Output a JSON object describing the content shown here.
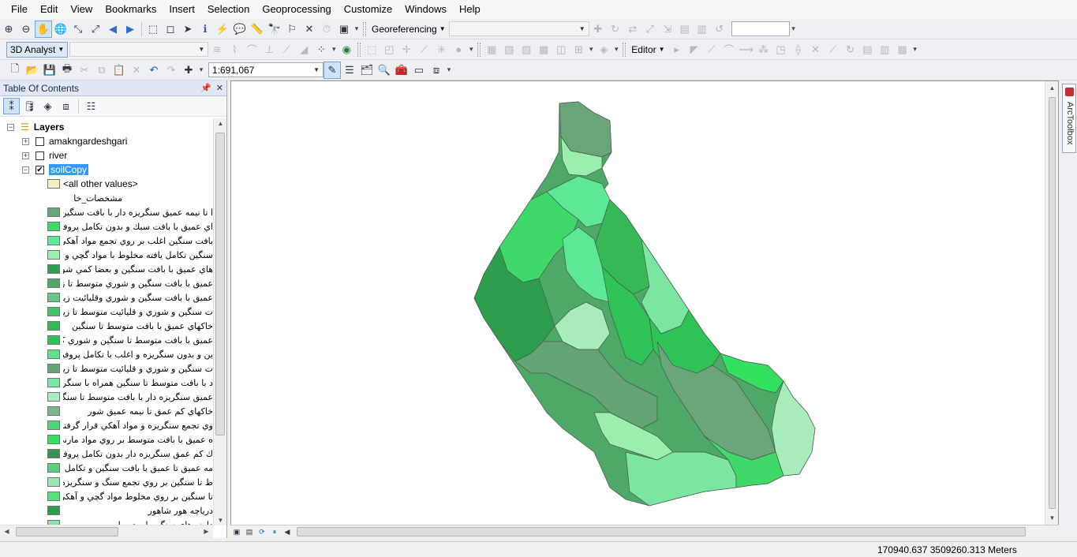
{
  "menu": [
    "File",
    "Edit",
    "View",
    "Bookmarks",
    "Insert",
    "Selection",
    "Geoprocessing",
    "Customize",
    "Windows",
    "Help"
  ],
  "toolbar_top": {
    "georef_label": "Georeferencing",
    "georef_layer_value": "",
    "find_value": ""
  },
  "toolbar_mid": {
    "analyst_label": "3D Analyst",
    "analyst_layer_value": "",
    "editor_label": "Editor"
  },
  "toolbar_std": {
    "scale_value": "1:691,067"
  },
  "toc": {
    "title": "Table Of Contents",
    "root_label": "Layers",
    "layers": [
      {
        "name": "amakngardeshgari",
        "checked": false,
        "expanded": false
      },
      {
        "name": "river",
        "checked": false,
        "expanded": false
      },
      {
        "name": "soilCopy",
        "checked": true,
        "expanded": true,
        "selected": true
      }
    ],
    "other_values_label": "<all other values>",
    "field_heading": "مشخصات_خا",
    "legend": [
      {
        "label": "ا تا نيمه عميق سنگريزه دار با بافت سنگين",
        "color": "#6aa57a"
      },
      {
        "label": "اي عميق با بافت سبك و بدون تكامل پروفيلي",
        "color": "#3fd96a"
      },
      {
        "label": "بافت سنگين اغلب بر روي تجمع مواد آهكي",
        "color": "#5ce896"
      },
      {
        "label": "سنگين تكامل يافته مخلوط با مواد گچي و آهكي",
        "color": "#9aeeae"
      },
      {
        "label": "هاي عميق با بافت سنگين و بعضا كمي شور",
        "color": "#2e9e4e"
      },
      {
        "label": "عميق با بافت سنگين و شوري متوسط تا زياد",
        "color": "#4ea868"
      },
      {
        "label": "عميق با بافت سنگين و شوري وقليائيت زياد",
        "color": "#6cc488"
      },
      {
        "label": "ت سنگين و شوري و قليائيت متوسط تا زياد",
        "color": "#44c26a"
      },
      {
        "label": "خاكهاي عميق با بافت متوسط تا سنگين",
        "color": "#35b855"
      },
      {
        "label": "عميق با بافت متوسط تا سنگين و شوري كم",
        "color": "#2fc257"
      },
      {
        "label": "ين و بدون سنگريزه و اغلب با تكامل پروفيلي",
        "color": "#5fe08a"
      },
      {
        "label": "ت سنگين و شوري و قليائيت متوسط تا زياد",
        "color": "#62a474"
      },
      {
        "label": "د با بافت متوسط تا سنگين همراه با سنگريزه",
        "color": "#7ae6a2"
      },
      {
        "label": "عميق سنگريزه دار با بافت متوسط تا سنگين",
        "color": "#a8ecbc"
      },
      {
        "label": "خاكهاي كم عمق تا نيمه عميق شور",
        "color": "#7fb48e"
      },
      {
        "label": "وي تجمع سنگريزه و مواد آهكي قرار گرفته",
        "color": "#49d978"
      },
      {
        "label": "ه عميق با بافت متوسط بر روي مواد مارني",
        "color": "#33e060"
      },
      {
        "label": "ك كم عمق سنگريزه دار بدون تكامل پروفيلي",
        "color": "#3c8e56"
      },
      {
        "label": "مه عميق تا عميق با بافت سنگين و تكامل پ",
        "color": "#58d07c"
      },
      {
        "label": "ط تا سنگين بر روي تجمع سنگ و سنگريزه",
        "color": "#9de8b2"
      },
      {
        "label": "تا سنگين بر روي مخلوط مواد گچي و آهكي",
        "color": "#56e07e"
      },
      {
        "label": "درياچه هور شاهور",
        "color": "#2f9a4a"
      },
      {
        "label": "دامنه هاي سنگي با محصوله",
        "color": "#8ee0a8"
      }
    ]
  },
  "map": {
    "colors": [
      "#4ea868",
      "#3fd96a",
      "#5ce896",
      "#9aeeae",
      "#2e9e4e",
      "#6aa57a",
      "#35b855",
      "#7ae6a2",
      "#a8ecbc",
      "#62a474",
      "#2fc257",
      "#33e060"
    ]
  },
  "dock": {
    "arctoolbox_label": "ArcToolbox"
  },
  "status": {
    "coordinates": "170940.637  3509260.313 Meters"
  }
}
